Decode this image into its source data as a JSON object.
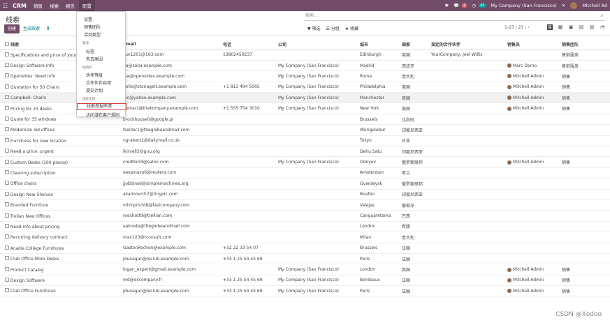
{
  "topbar": {
    "brand": "CRM",
    "menu": [
      "销售",
      "线索",
      "报告",
      "配置"
    ],
    "active": "配置",
    "badge1": "3",
    "badge2": "45",
    "company": "My Company (San Francisco)",
    "user": "Mitchell Ad"
  },
  "page": {
    "title": "线索",
    "search_placeholder": "搜索...",
    "create": "创建",
    "generate": "生成线索",
    "filter": "筛选",
    "group": "分组",
    "fav": "收藏",
    "pager": "1-23 / 23"
  },
  "dropdown": {
    "items": [
      "设置",
      "销售团队",
      "活动类型"
    ],
    "sec1": "渠道",
    "sec1_items": [
      "标签",
      "失去原因"
    ],
    "sec2": "经销商",
    "sec2_items": [
      "伙伴等级",
      "合作伙伴启用",
      "提交计划"
    ],
    "sec3": "线索生成",
    "sec3_items": [
      "线索挖掘申请",
      "访问潜在客户规则"
    ]
  },
  "columns": [
    "线索",
    "Email",
    "电话",
    "公司",
    "城市",
    "国家",
    "指定的合作伙伴",
    "销售员",
    "销售团队"
  ],
  "rows": [
    [
      "Specifications and price of your",
      "sun1201@163.com",
      "13802450237",
      "",
      "Edinburgh",
      "英国",
      "YourCompany, Joel Willis",
      "",
      "售前服务"
    ],
    [
      "Design Software Info",
      "ga@solar.example.com",
      "",
      "My Company (San Francisco)",
      "Madrid",
      "西班牙",
      "",
      "Marc Demo",
      "售前服务"
    ],
    [
      "Opensides: Need Info",
      "ina@opensides.example.com",
      "",
      "My Company (San Francisco)",
      "Roma",
      "意大利",
      "",
      "Mitchell Admin",
      "销售"
    ],
    [
      "Quotation for 50 Chairs",
      "helle@stonageit.example.com",
      "+1 813 494 5005",
      "My Company (San Francisco)",
      "Philadelphia",
      "美国",
      "",
      "Mitchell Admin",
      "销售"
    ],
    [
      "Campbell: Chairs",
      "mc@yahoo.example.com",
      "",
      "My Company (San Francisco)",
      "Manchester",
      "英国",
      "",
      "Mitchell Admin",
      "销售"
    ],
    [
      "Pricing for 25 desks",
      "contact@thekompany.example.com",
      "+1 555 754 3010",
      "My Company (San Francisco)",
      "New York",
      "美国",
      "",
      "Mitchell Admin",
      "销售"
    ],
    [
      "Quote for 35 windows",
      "brockhouse0@google.pl",
      "",
      "",
      "Brussels",
      "比利时",
      "",
      "",
      ""
    ],
    [
      "Modernize old offices",
      "fseiller1@theglobeandmail.com",
      "",
      "",
      "Wurigelebur",
      "印度尼西亚",
      "",
      "",
      ""
    ],
    [
      "Furnitures for new location",
      "ngrabert2@dailymail.co.uk",
      "",
      "",
      "Tokyo",
      "日本",
      "",
      "",
      ""
    ],
    [
      "Need a price: urgent",
      "ikirvell3@gnu.org",
      "",
      "",
      "Dehu Satu",
      "印度尼西亚",
      "",
      "",
      ""
    ],
    [
      "Custom Desks (100 pieces)",
      "credford4@salon.com",
      "",
      "My Company (San Francisco)",
      "Odoyev",
      "俄罗斯联邦",
      "",
      "Mitchell Admin",
      "销售"
    ],
    [
      "Cleaning subscription",
      "eespinazo6@reuters.com",
      "",
      "",
      "Amsterdam",
      "荷兰",
      "",
      "",
      ""
    ],
    [
      "Office chairs",
      "jjobbins6@simplemachines.org",
      "",
      "",
      "Gvardeysk",
      "俄罗斯联邦",
      "",
      "",
      ""
    ],
    [
      "Design New Shelves",
      "akalinovich7@tinypic.com",
      "",
      "",
      "Boafeo",
      "印度尼西亚",
      "",
      "",
      ""
    ],
    [
      "Branded Furniture",
      "mlimpricht8@fastcompany.com",
      "",
      "",
      "Valejas",
      "葡萄牙",
      "",
      "",
      ""
    ],
    [
      "Trelian New Offices",
      "roeshott9@trellian.com",
      "",
      "",
      "Canguaretama",
      "巴西",
      "",
      "",
      ""
    ],
    [
      "Need info about pricing",
      "aakreda@theglobeandmail.com",
      "",
      "",
      "London",
      "希腊",
      "",
      "",
      ""
    ],
    [
      "Recurring delivery contract",
      "max123@tconsult.com",
      "",
      "",
      "Milan",
      "意大利",
      "",
      "",
      ""
    ],
    [
      "Acadia College Furnitures",
      "GastonRochon@example.com",
      "+32 22 33 54 07",
      "",
      "Brussels",
      "法国",
      "",
      "",
      ""
    ],
    [
      "Club Office More Desks",
      "jdunagan@leclub.example.com",
      "+33 1 25 54 45 69",
      "",
      "Paris",
      "法国",
      "",
      "",
      ""
    ],
    [
      "Product Catalog",
      "logan_expert@gmail.example.com",
      "",
      "My Company (San Francisco)",
      "London",
      "英国",
      "",
      "Mitchell Admin",
      "销售"
    ],
    [
      "Design Software",
      "md@oilcompany.fr",
      "+33 1 25 54 45 69",
      "My Company (San Francisco)",
      "Bordeaux",
      "法国",
      "",
      "Mitchell Admin",
      "销售"
    ],
    [
      "Club Office Furnitures",
      "jdunagan@leclub.example.com",
      "+33 1 25 54 45 69",
      "My Company (San Francisco)",
      "Paris",
      "法国",
      "",
      "Mitchell Admin",
      "销售"
    ]
  ],
  "watermark": "CSDN @Xodoo"
}
